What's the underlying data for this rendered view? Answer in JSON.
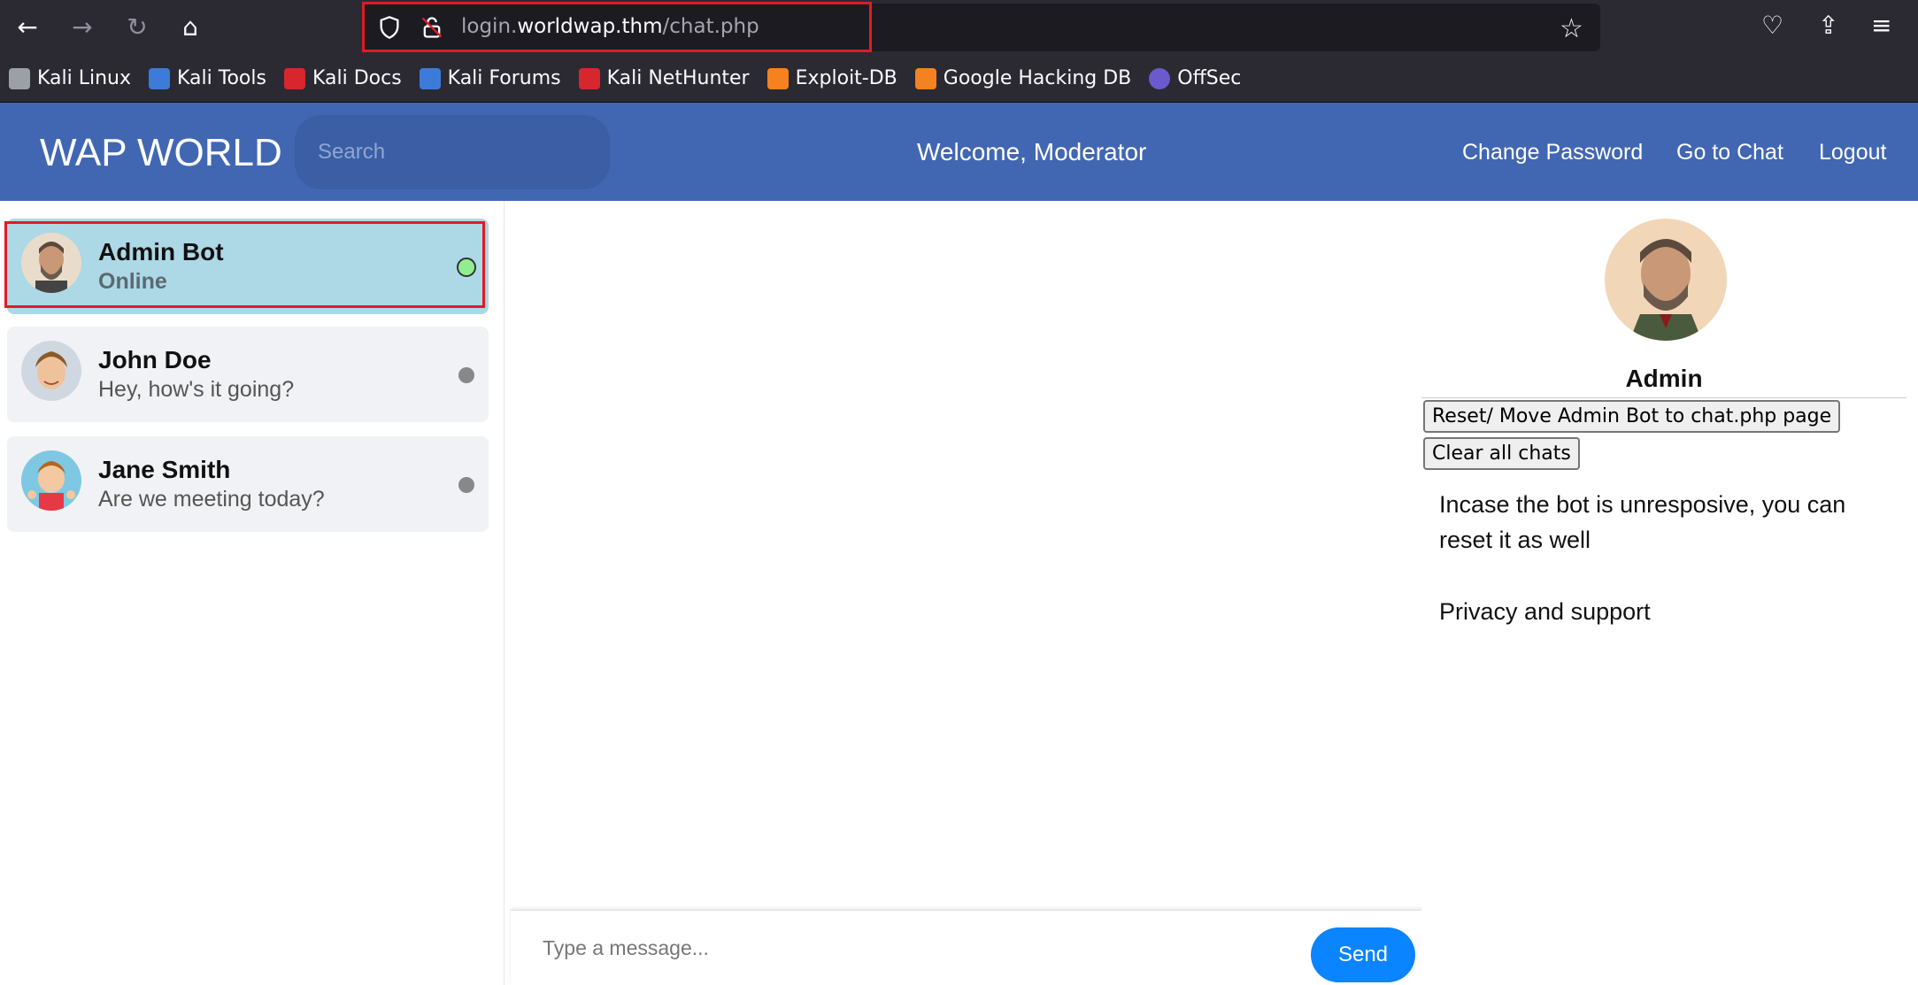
{
  "browser": {
    "url_prefix": "login.",
    "url_domain": "worldwap.thm",
    "url_path": "/chat.php",
    "bookmarks": [
      "Kali Linux",
      "Kali Tools",
      "Kali Docs",
      "Kali Forums",
      "Kali NetHunter",
      "Exploit-DB",
      "Google Hacking DB",
      "OffSec"
    ],
    "bookmark_colors": [
      "#9aa0a6",
      "#3d7bd9",
      "#d8262e",
      "#3d7bd9",
      "#d8262e",
      "#f5821f",
      "#f5821f",
      "#6a5acd"
    ]
  },
  "header": {
    "brand": "WAP WORLD",
    "search_placeholder": "Search",
    "welcome": "Welcome, Moderator",
    "links": [
      "Change Password",
      "Go to Chat",
      "Logout"
    ],
    "bg_color": "#4267b2"
  },
  "contacts": [
    {
      "name": "Admin Bot",
      "sub": "Online",
      "status": "online"
    },
    {
      "name": "John Doe",
      "sub": "Hey, how's it going?",
      "status": "offline"
    },
    {
      "name": "Jane Smith",
      "sub": "Are we meeting today?",
      "status": "offline"
    }
  ],
  "message_bar": {
    "placeholder": "Type a message...",
    "send_label": "Send"
  },
  "profile": {
    "name": "Admin",
    "reset_button": "Reset/ Move Admin Bot to chat.php page",
    "clear_button": "Clear all chats",
    "note": "Incase the bot is unresposive, you can reset it as well",
    "privacy": "Privacy and support"
  }
}
